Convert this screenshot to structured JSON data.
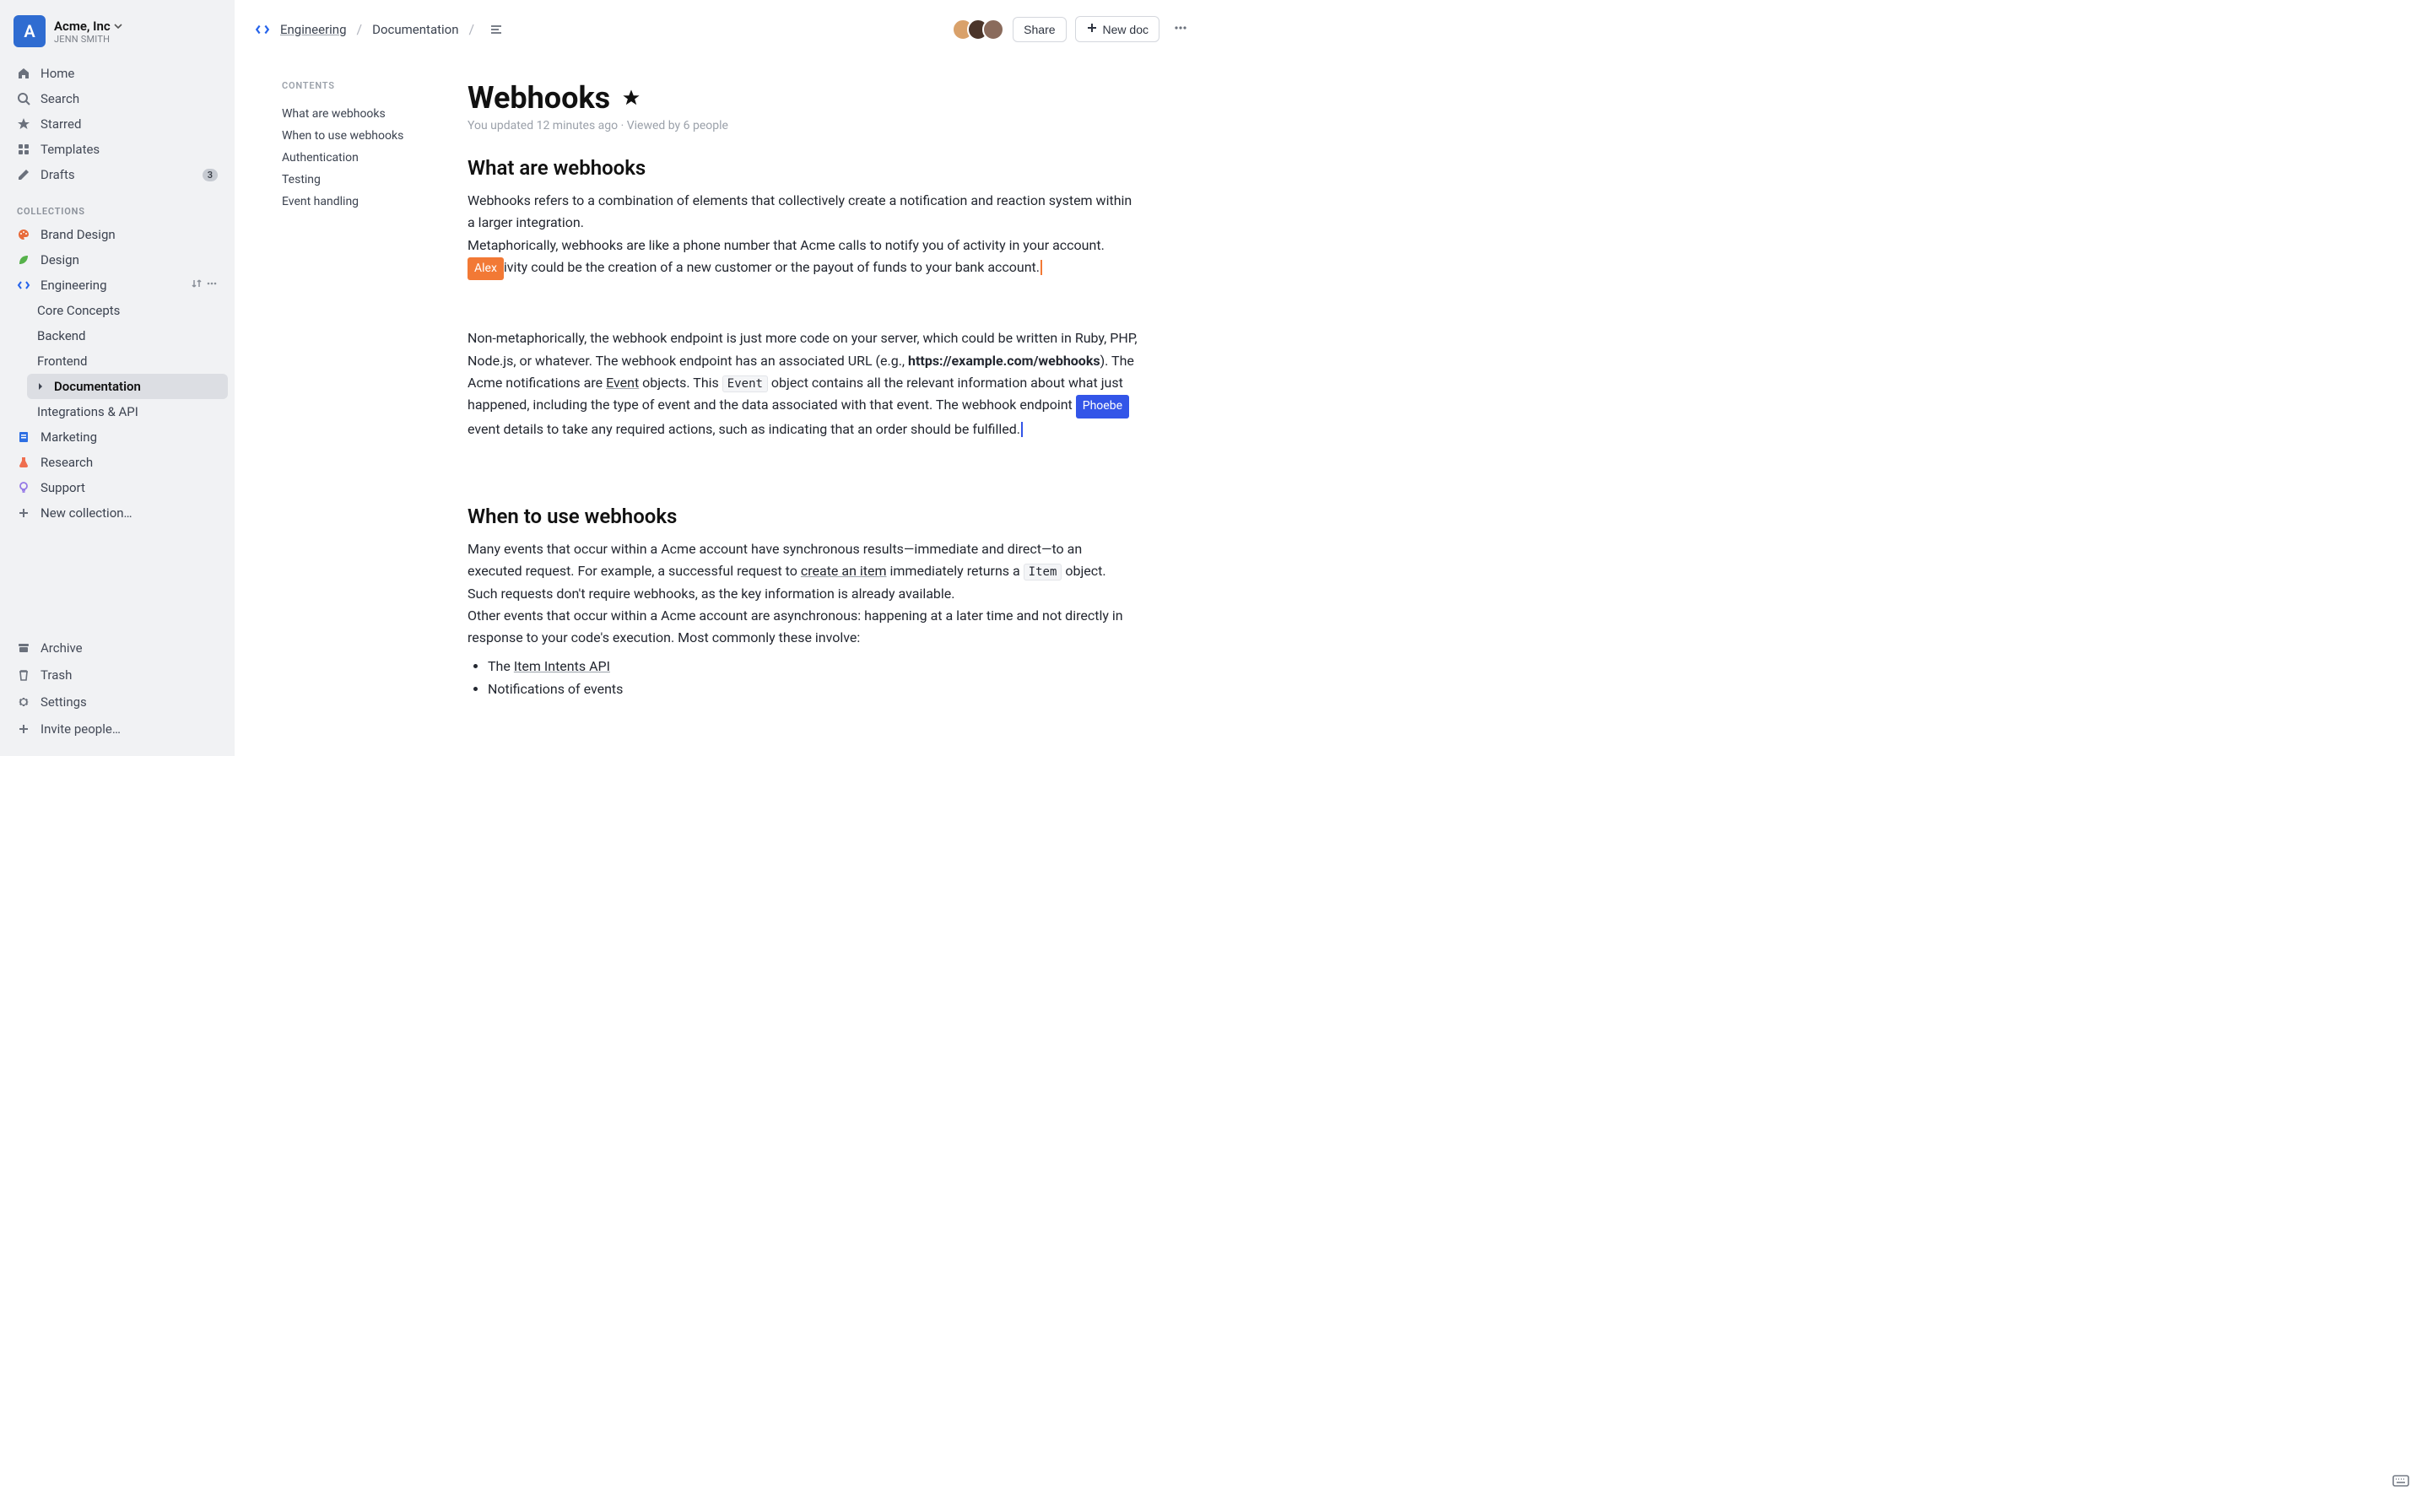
{
  "workspace": {
    "avatar_letter": "A",
    "name": "Acme, Inc",
    "user": "JENN SMITH"
  },
  "nav": {
    "home": "Home",
    "search": "Search",
    "starred": "Starred",
    "templates": "Templates",
    "drafts": "Drafts",
    "drafts_badge": "3"
  },
  "sections": {
    "collections": "COLLECTIONS"
  },
  "collections": [
    {
      "label": "Brand Design",
      "icon_color": "#e86b3a"
    },
    {
      "label": "Design",
      "icon_color": "#56b24a"
    },
    {
      "label": "Engineering",
      "icon_color": "#2563eb",
      "active": true,
      "children": [
        "Core Concepts",
        "Backend",
        "Frontend",
        "Documentation",
        "Integrations & API"
      ],
      "selected_child": "Documentation"
    },
    {
      "label": "Marketing",
      "icon_color": "#2d6fe3"
    },
    {
      "label": "Research",
      "icon_color": "#ef6e4f"
    },
    {
      "label": "Support",
      "icon_color": "#9478e6"
    }
  ],
  "new_collection": "New collection…",
  "bottom_nav": {
    "archive": "Archive",
    "trash": "Trash",
    "settings": "Settings",
    "invite": "Invite people…"
  },
  "topbar": {
    "crumb1": "Engineering",
    "crumb2": "Documentation",
    "share": "Share",
    "new_doc": "New doc"
  },
  "toc": {
    "title": "CONTENTS",
    "items": [
      "What are webhooks",
      "When to use webhooks",
      "Authentication",
      "Testing",
      "Event handling"
    ]
  },
  "doc": {
    "title": "Webhooks",
    "meta": "You updated 12 minutes ago · Viewed by 6 people",
    "h_what": "What are webhooks",
    "p1": "Webhooks refers to a combination of elements that collectively create a notification and reaction system within a larger integration.",
    "p2a": "Metaphorically, webhooks are like a phone number that Acme calls to notify you of activity in your account.",
    "alex": "Alex",
    "p2b": "ivity could be the creation of a new customer or the payout of funds to your bank account.",
    "p3a": "Non-metaphorically, the webhook endpoint is just more code on your server, which could be written in Ruby, PHP, Node.js, or whatever. The webhook endpoint has an associated URL (e.g., ",
    "p3_url": "https://example.com/webhooks",
    "p3b": "). The Acme notifications are ",
    "p3_link1": "Event",
    "p3c": " objects. This ",
    "p3_code": "Event",
    "p3d": " object contains all the relevant information about what just happened, including the type of event and the data associated with that event. The webhook endpoint ",
    "phoebe": "Phoebe",
    "p3e": "event details to take any required actions, such as indicating that an order should be fulfilled.",
    "h_when": "When to use webhooks",
    "p4a": "Many events that occur within a Acme account have synchronous results—immediate and direct—to an executed request. For example, a successful request to ",
    "p4_link": "create an item",
    "p4b": " immediately returns a ",
    "p4_code": "Item",
    "p4c": " object. Such requests don't require webhooks, as the key information is already available.",
    "p5": "Other events that occur within a Acme account are asynchronous: happening at a later time and not directly in response to your code's execution. Most commonly these involve:",
    "li1a": "The ",
    "li1_link": "Item Intents API",
    "li2": "Notifications of events"
  }
}
